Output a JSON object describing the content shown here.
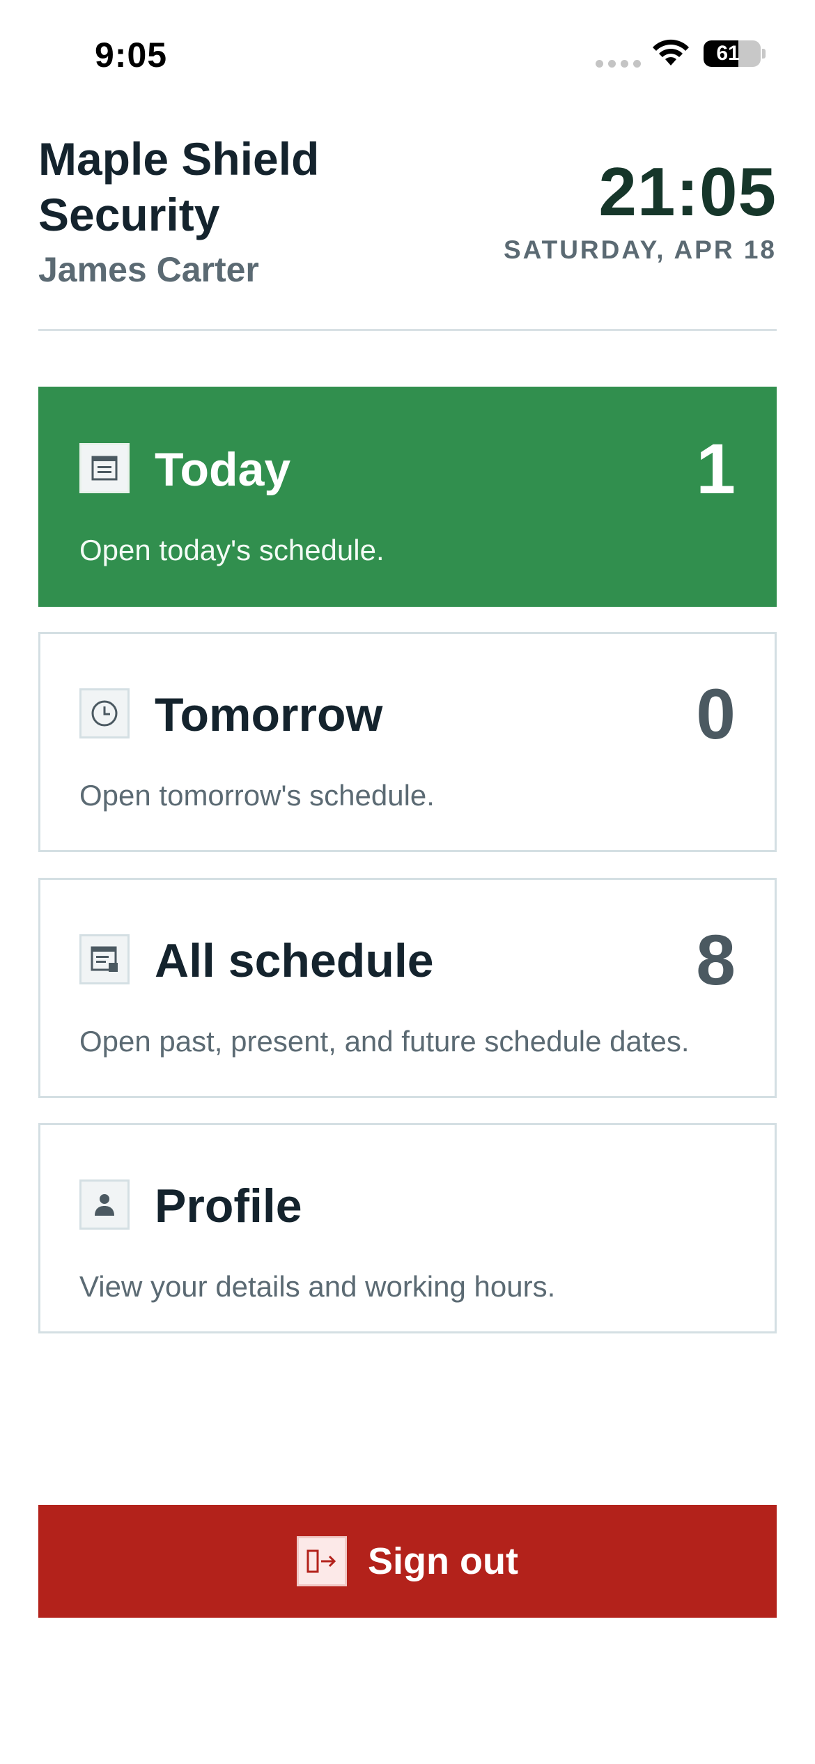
{
  "status_bar": {
    "time": "9:05",
    "battery_level": "61",
    "battery_fraction": 0.61
  },
  "header": {
    "company": "Maple Shield Security",
    "user_name": "James Carter",
    "clock": "21:05",
    "date": "SATURDAY, APR 18"
  },
  "cards": [
    {
      "title": "Today",
      "count": "1",
      "description": "Open today's schedule.",
      "icon": "calendar-icon"
    },
    {
      "title": "Tomorrow",
      "count": "0",
      "description": "Open tomorrow's schedule.",
      "icon": "clock-icon"
    },
    {
      "title": "All schedule",
      "count": "8",
      "description": "Open past, present, and future schedule dates.",
      "icon": "schedule-list-icon"
    },
    {
      "title": "Profile",
      "description": "View your details and working hours.",
      "icon": "person-icon"
    }
  ],
  "sign_out": {
    "label": "Sign out",
    "icon": "sign-out-icon"
  },
  "colors": {
    "accent_green": "#318f4e",
    "danger_red": "#b3221b",
    "text_dark": "#14232d",
    "text_muted": "#5b6a73"
  }
}
